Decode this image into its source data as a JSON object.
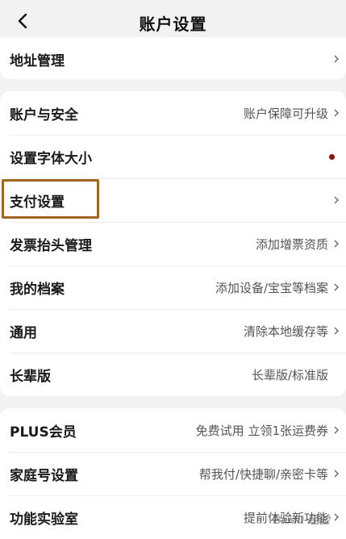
{
  "header": {
    "title": "账户设置"
  },
  "groups": {
    "address": {
      "label": "地址管理"
    },
    "account_security": {
      "label": "账户与安全",
      "value": "账户保障可升级"
    },
    "font_size": {
      "label": "设置字体大小",
      "has_badge": true
    },
    "payment": {
      "label": "支付设置"
    },
    "invoice": {
      "label": "发票抬头管理",
      "value": "添加增票资质"
    },
    "profile": {
      "label": "我的档案",
      "value": "添加设备/宝宝等档案"
    },
    "general": {
      "label": "通用",
      "value": "清除本地缓存等"
    },
    "elder_mode": {
      "label": "长辈版",
      "value": "长辈版/标准版"
    },
    "plus": {
      "label": "PLUS会员",
      "value": "免费试用 立领1张运费券"
    },
    "family": {
      "label": "家庭号设置",
      "value": "帮我付/快捷聊/亲密卡等"
    },
    "lab": {
      "label": "功能实验室",
      "value": "提前体验新功能"
    }
  },
  "watermark": "Baidu 经验",
  "colors": {
    "background": "#f2f2f2",
    "card": "#ffffff",
    "highlight_border": "#a0651e",
    "badge_dot": "#8b1010"
  },
  "icons": {
    "back": "chevron-left-icon",
    "row_arrow": "chevron-right-icon"
  }
}
